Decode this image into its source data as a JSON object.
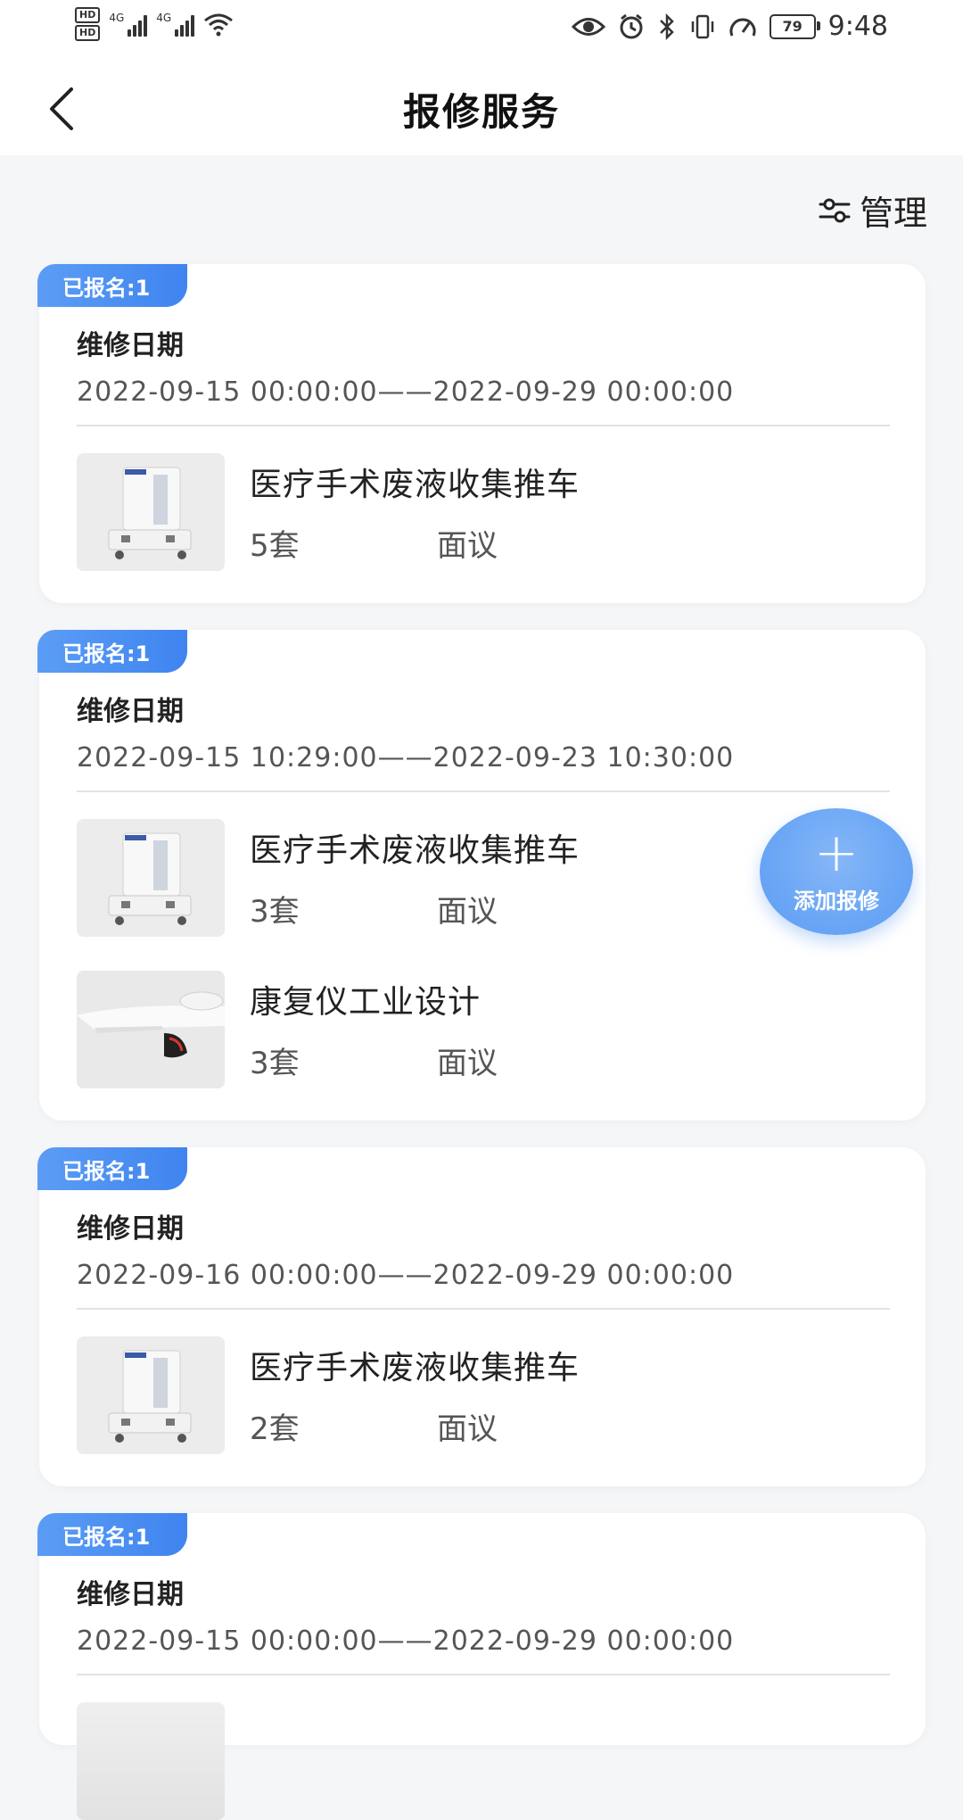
{
  "status_bar": {
    "hd_1": "HD",
    "hd_2": "HD",
    "net_1": "4G",
    "net_2": "4G",
    "battery": "79",
    "time": "9:48"
  },
  "nav": {
    "title": "报修服务"
  },
  "manage": {
    "label": "管理"
  },
  "fab": {
    "plus": "+",
    "label": "添加报修"
  },
  "cards": [
    {
      "badge": "已报名:1",
      "date_label": "维修日期",
      "date_range": "2022-09-15 00:00:00——2022-09-29 00:00:00",
      "items": [
        {
          "name": "医疗手术废液收集推车",
          "qty": "5套",
          "price": "面议",
          "thumb": "cart"
        }
      ]
    },
    {
      "badge": "已报名:1",
      "date_label": "维修日期",
      "date_range": "2022-09-15 10:29:00——2022-09-23 10:30:00",
      "items": [
        {
          "name": "医疗手术废液收集推车",
          "qty": "3套",
          "price": "面议",
          "thumb": "cart"
        },
        {
          "name": "康复仪工业设计",
          "qty": "3套",
          "price": "面议",
          "thumb": "device"
        }
      ]
    },
    {
      "badge": "已报名:1",
      "date_label": "维修日期",
      "date_range": "2022-09-16 00:00:00——2022-09-29 00:00:00",
      "items": [
        {
          "name": "医疗手术废液收集推车",
          "qty": "2套",
          "price": "面议",
          "thumb": "cart"
        }
      ]
    },
    {
      "badge": "已报名:1",
      "date_label": "维修日期",
      "date_range": "2022-09-15 00:00:00——2022-09-29 00:00:00",
      "items": []
    }
  ]
}
